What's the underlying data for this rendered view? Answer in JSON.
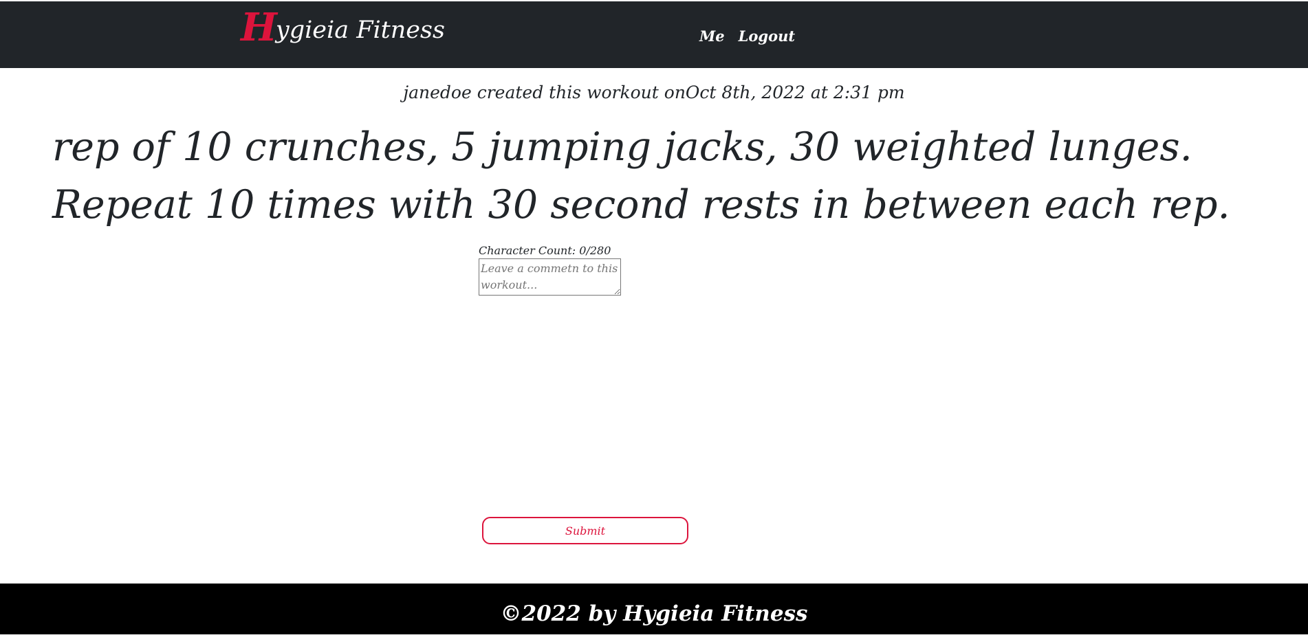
{
  "header": {
    "brand_initial": "H",
    "brand_rest": "ygieia Fitness",
    "nav": {
      "me": "Me",
      "logout": "Logout"
    },
    "colors": {
      "background": "#212529",
      "accent": "#dc143c"
    }
  },
  "workout": {
    "meta": "janedoe created this workout onOct 8th, 2022 at 2:31 pm",
    "text": "rep of 10 crunches, 5 jumping jacks, 30 weighted lunges. Repeat 10 times with 30 second rests in between each rep."
  },
  "comment": {
    "char_count": "Character Count: 0/280",
    "placeholder": "Leave a commetn to this workout...",
    "value": "",
    "submit_label": "Submit"
  },
  "footer": {
    "text": "©2022 by Hygieia Fitness"
  }
}
